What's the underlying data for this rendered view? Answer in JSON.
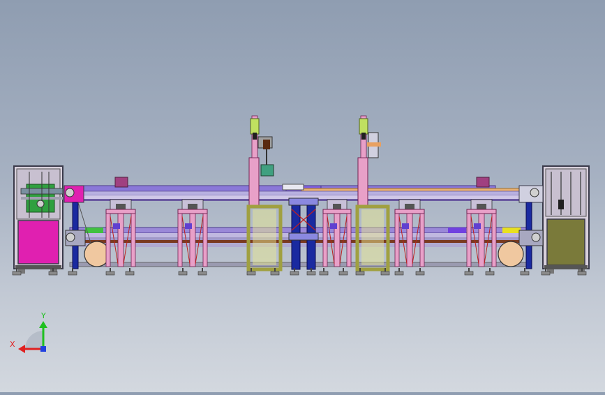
{
  "triad": {
    "y_label": "Y",
    "x_label": "X"
  },
  "colors": {
    "frame_dark": "#3a3a4a",
    "magenta": "#e020b0",
    "olive": "#7a7a3a",
    "purple_rail": "#8a78d8",
    "orange_rail": "#e8b070",
    "blue_post": "#1a2aa0",
    "pink": "#e8a0c8",
    "yellow": "#e8e890",
    "green": "#40c040",
    "axis_y": "#20c020",
    "axis_x": "#e02020",
    "axis_z": "#2040e0"
  }
}
